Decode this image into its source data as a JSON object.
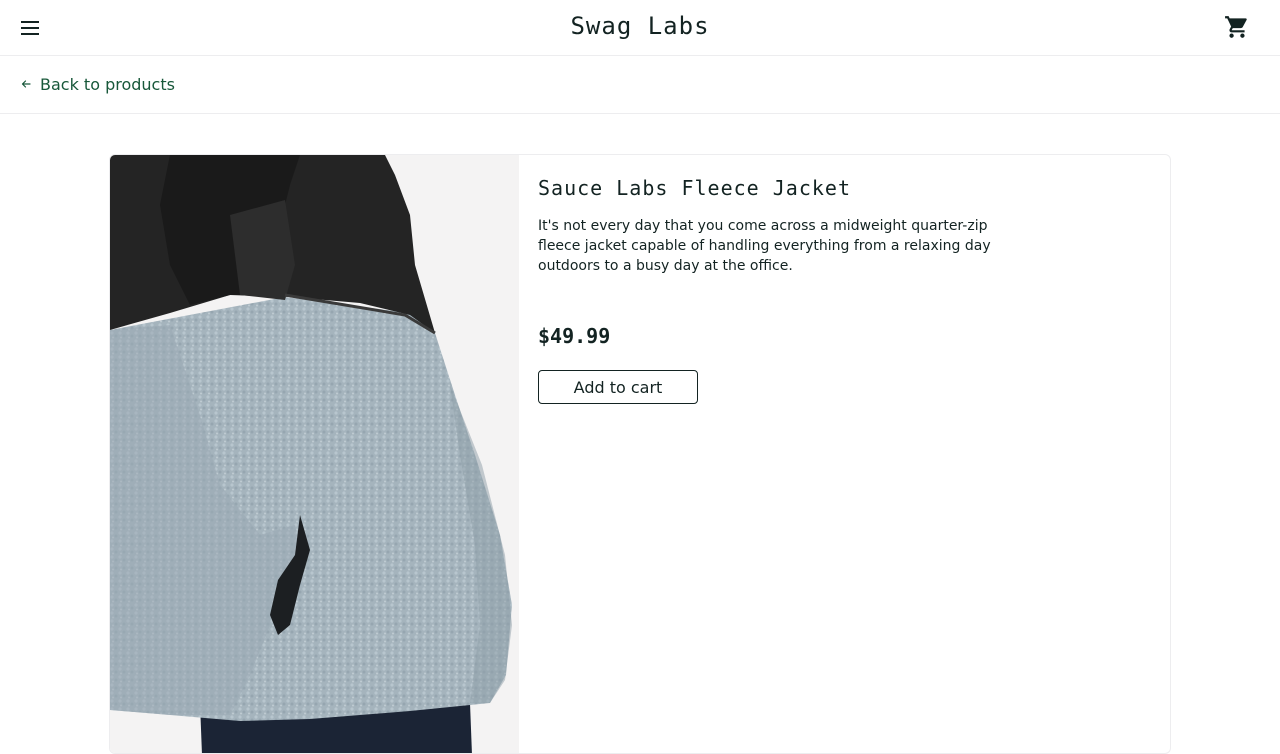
{
  "header": {
    "title": "Swag Labs",
    "menu_icon": "hamburger-menu-icon",
    "cart_icon": "shopping-cart-icon"
  },
  "subheader": {
    "back_label": "Back to products",
    "back_icon": "arrow-left-icon"
  },
  "product": {
    "name": "Sauce Labs Fleece Jacket",
    "description": "It's not every day that you come across a midweight quarter-zip fleece jacket capable of handling everything from a relaxing day outdoors to a busy day at the office.",
    "price": "$49.99",
    "add_to_cart_label": "Add to cart",
    "image_alt": "Sauce Labs Fleece Jacket"
  },
  "colors": {
    "text": "#132322",
    "accent": "#18583a",
    "border": "#ededef"
  }
}
